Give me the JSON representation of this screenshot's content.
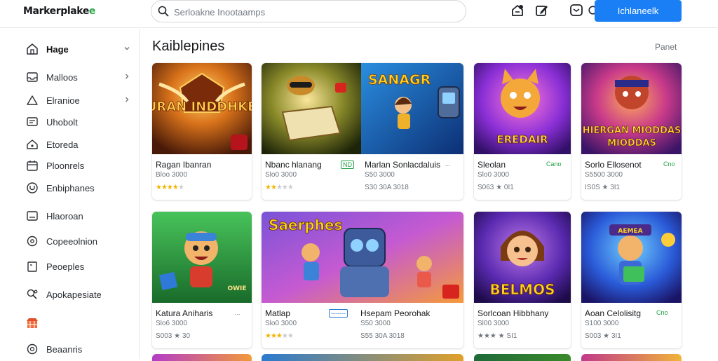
{
  "app": {
    "logo_main": "Markerplake",
    "logo_accent": "e"
  },
  "search": {
    "placeholder": "Serloakne Inootaamps"
  },
  "header": {
    "cta_label": "Ichlaneelk"
  },
  "sidebar": {
    "items": [
      {
        "label": "Hage",
        "icon": "home-icon",
        "chevron": true,
        "active": true
      },
      {
        "label": "Malloos",
        "icon": "inbox-icon",
        "chevron": true
      },
      {
        "label": "Elranioe",
        "icon": "triangle-icon",
        "chevron": true
      },
      {
        "label": "Uhobolt",
        "icon": "chat-icon",
        "chevron": false
      },
      {
        "label": "Etoreda",
        "icon": "house-icon",
        "chevron": false
      },
      {
        "label": "Ploonrels",
        "icon": "calendar-icon",
        "chevron": false
      },
      {
        "label": "Enbiphanes",
        "icon": "shield-icon",
        "chevron": false
      },
      {
        "label": "Hlaoroan",
        "icon": "list-icon",
        "chevron": false
      },
      {
        "label": "Copeeolnion",
        "icon": "circle-icon",
        "chevron": false
      },
      {
        "label": "Peoeples",
        "icon": "book-icon",
        "chevron": false
      },
      {
        "label": "Apokapesiate",
        "icon": "search-people-icon",
        "chevron": false
      },
      {
        "label": "",
        "icon": "store-icon",
        "chevron": false
      },
      {
        "label": "Beaanris",
        "icon": "coin-icon",
        "chevron": false
      }
    ]
  },
  "main": {
    "title": "Kaiblepines",
    "more_label": "Panet"
  },
  "cards": [
    {
      "title": "Ragan Ibanran",
      "sub": "Bloo 3000",
      "rating_text": "",
      "stars": 4,
      "badge": "",
      "art_text": "HIBURAN INDDHKBOIA"
    },
    {
      "title": "Nbanc hlanang",
      "sub": "Slo0 3000",
      "rating_text": "",
      "stars": 2,
      "badge": "ND",
      "art_text": ""
    },
    {
      "title": "Marlan Sonlacdaluis",
      "sub": "S50 3000",
      "rating_text": "S30 30A 3018",
      "stars": 0,
      "badge": "...",
      "art_text": "SANAGR"
    },
    {
      "title": "Sleolan",
      "sub": "Slo0 3000",
      "rating_text": "S063 ★ 0I1",
      "stars": 0,
      "badge": "Cano",
      "art_text": "EREDAIR"
    },
    {
      "title": "Sorlo Ellosenot",
      "sub": "S5500 3000",
      "rating_text": "IS0S ★ 3I1",
      "stars": 0,
      "badge": "Cno",
      "art_text": "HIERGAN MIODDAS"
    },
    {
      "title": "Katura Aniharis",
      "sub": "Slo6 3000",
      "rating_text": "S003 ★ 30",
      "stars": 0,
      "badge": "...",
      "art_text": "OWIE"
    },
    {
      "title": "Matlap",
      "sub": "Slo0 3000",
      "rating_text": "",
      "stars": 3,
      "badge": "-------",
      "art_text": "Saerphes"
    },
    {
      "title": "Hsepam Peorohak",
      "sub": "S50 3000",
      "rating_text": "S55 30A 3018",
      "stars": 0,
      "badge": "",
      "art_text": ""
    },
    {
      "title": "Sorlcoan Hibbhany",
      "sub": "Sl00 3000",
      "rating_text": "★★★ ★ SI1",
      "stars": 0,
      "badge": "",
      "art_text": "BELMOS"
    },
    {
      "title": "Aoan Celolisitg",
      "sub": "S100 3000",
      "rating_text": "S003 ★ 3I1",
      "stars": 0,
      "badge": "Cno",
      "art_text": "AEMEA"
    }
  ]
}
